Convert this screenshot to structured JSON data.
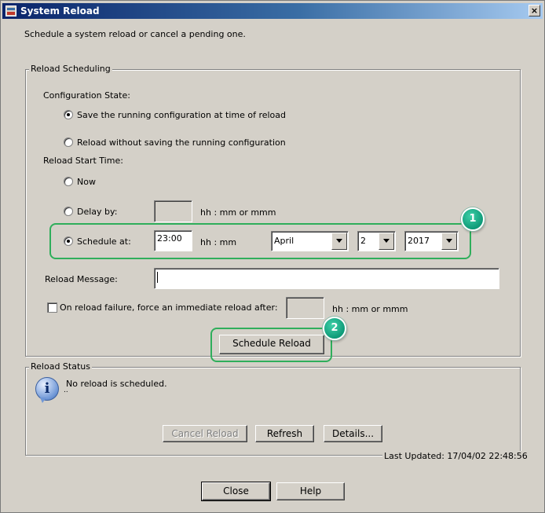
{
  "window": {
    "title": "System Reload",
    "close_glyph": "×",
    "description": "Schedule a system reload or cancel a pending one."
  },
  "reload_scheduling": {
    "legend": "Reload Scheduling",
    "configuration_state": {
      "label": "Configuration State:",
      "options": [
        {
          "label": "Save the running configuration at time of reload",
          "selected": true
        },
        {
          "label": "Reload without saving the running configuration",
          "selected": false
        }
      ]
    },
    "start_time": {
      "label": "Reload Start Time:",
      "now_label": "Now",
      "delay_label": "Delay by:",
      "delay_value": "",
      "delay_hint": "hh : mm or mmm",
      "schedule_label": "Schedule at:",
      "schedule_time": "23:00",
      "schedule_hint": "hh : mm",
      "month": "April",
      "day": "2",
      "year": "2017",
      "selected": "schedule"
    },
    "message": {
      "label": "Reload Message:",
      "value": ""
    },
    "force_reload": {
      "label": "On reload failure, force an immediate reload after:",
      "value": "",
      "hint": "hh : mm or mmm",
      "checked": false
    },
    "schedule_button": "Schedule Reload"
  },
  "reload_status": {
    "legend": "Reload Status",
    "message": "No reload is scheduled.",
    "message_detail": "..",
    "icon": "info-icon",
    "buttons": {
      "cancel": "Cancel Reload",
      "refresh": "Refresh",
      "details": "Details..."
    },
    "last_updated": "Last Updated: 17/04/02 22:48:56"
  },
  "footer": {
    "close": "Close",
    "help": "Help"
  },
  "annotations": {
    "badge_1": "1",
    "badge_2": "2",
    "highlight_color": "#2fae5b",
    "badge_color": "#0e9a78"
  }
}
